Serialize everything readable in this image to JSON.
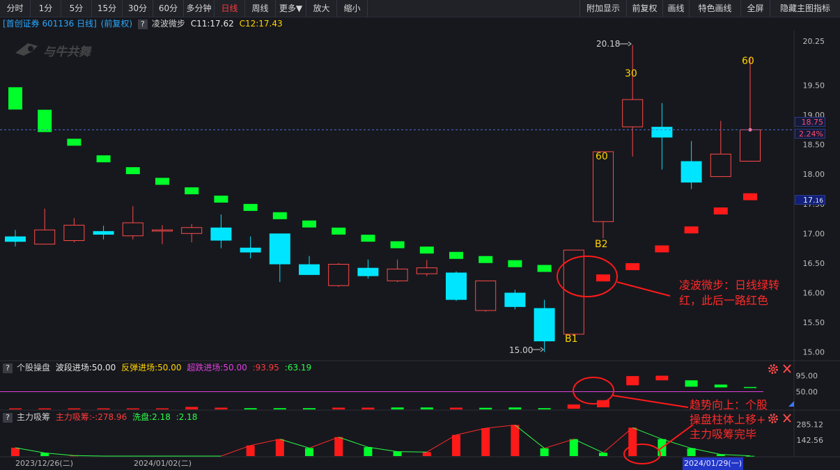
{
  "toolbar": {
    "left": [
      "分时",
      "1分",
      "5分",
      "15分",
      "30分",
      "60分",
      "多分钟",
      "日线",
      "周线",
      "更多▼",
      "放大",
      "缩小"
    ],
    "active": "日线",
    "right": [
      "附加显示",
      "前复权",
      "画线",
      "特色画线",
      "全屏",
      "隐藏主图指标"
    ]
  },
  "info": {
    "stock": "[首创证券 601136 日线]",
    "adj": "(前复权)",
    "help": "?",
    "indicator": "凌波微步",
    "c1": "C11:17.62",
    "c2": "C12:17.43"
  },
  "watermark": "与牛共舞",
  "price_axis": [
    "20.25",
    "19.50",
    "19.00",
    "18.50",
    "18.00",
    "17.50",
    "17.00",
    "16.50",
    "16.00",
    "15.50",
    "15.00"
  ],
  "price_labels": {
    "current": "18.75",
    "change": "2.24%",
    "c1_mark": "17.",
    "c1_mark_tail": "16"
  },
  "markers": {
    "high": "20.18",
    "low": "15.00",
    "n30": "30",
    "n60a": "60",
    "n60b": "60",
    "b1": "B1",
    "b2": "B2"
  },
  "sub1": {
    "help": "?",
    "name": "个股操盘",
    "l1": "波段进场:50.00",
    "l2": "反弹进场:50.00",
    "l3": "超跌进场:50.00",
    "v1": ":93.95",
    "v2": ":63.19",
    "axis": [
      "95.00",
      "50.00"
    ]
  },
  "sub2": {
    "help": "?",
    "name": "主力吸筹",
    "l1": "主力吸筹:-",
    "v1": ":278.96",
    "l2": "洗盘:2.18",
    "v2": ":2.18",
    "axis": [
      "285.12",
      "142.56"
    ]
  },
  "dates": [
    "2023/12/26(二)",
    "2024/01/02(二)",
    "2024/01/29(一)"
  ],
  "annotations": {
    "a1_l1": "凌波微步：日线绿转",
    "a1_l2": "红，此后一路红色",
    "a2_l1": "趋势向上：个股",
    "a2_l2": "操盘柱体上移+",
    "a2_l3": "主力吸筹完毕"
  },
  "colors": {
    "up": "#ff3b3b",
    "down": "#00e5ff",
    "green": "#00ff2a",
    "red": "#ff1a1a",
    "yellow": "#ffd400",
    "magenta": "#e040e0",
    "bg": "#17181d"
  },
  "chart_data": {
    "type": "candlestick",
    "ylim": [
      14.9,
      20.4
    ],
    "candles": [
      {
        "o": 16.95,
        "c": 16.86,
        "h": 17.06,
        "l": 16.78
      },
      {
        "o": 16.82,
        "c": 17.06,
        "h": 17.42,
        "l": 16.82
      },
      {
        "o": 16.88,
        "c": 17.14,
        "h": 17.26,
        "l": 16.85
      },
      {
        "o": 17.04,
        "c": 16.98,
        "h": 17.13,
        "l": 16.9
      },
      {
        "o": 16.96,
        "c": 17.18,
        "h": 17.46,
        "l": 16.9
      },
      {
        "o": 17.04,
        "c": 17.06,
        "h": 17.14,
        "l": 16.82
      },
      {
        "o": 17.0,
        "c": 17.1,
        "h": 17.16,
        "l": 16.85
      },
      {
        "o": 17.1,
        "c": 16.88,
        "h": 17.32,
        "l": 16.75
      },
      {
        "o": 16.76,
        "c": 16.68,
        "h": 16.95,
        "l": 16.58
      },
      {
        "o": 17.0,
        "c": 16.48,
        "h": 17.0,
        "l": 16.18
      },
      {
        "o": 16.48,
        "c": 16.3,
        "h": 16.62,
        "l": 16.3
      },
      {
        "o": 16.12,
        "c": 16.48,
        "h": 16.5,
        "l": 16.1
      },
      {
        "o": 16.42,
        "c": 16.28,
        "h": 16.56,
        "l": 16.24
      },
      {
        "o": 16.2,
        "c": 16.4,
        "h": 16.56,
        "l": 16.18
      },
      {
        "o": 16.32,
        "c": 16.42,
        "h": 16.55,
        "l": 16.28
      },
      {
        "o": 16.34,
        "c": 15.88,
        "h": 16.36,
        "l": 15.86
      },
      {
        "o": 15.7,
        "c": 16.2,
        "h": 16.2,
        "l": 15.68
      },
      {
        "o": 16.0,
        "c": 15.76,
        "h": 16.05,
        "l": 15.72
      },
      {
        "o": 15.74,
        "c": 15.18,
        "h": 15.88,
        "l": 15.0
      },
      {
        "o": 15.3,
        "c": 16.72,
        "h": 16.72,
        "l": 15.28
      },
      {
        "o": 17.2,
        "c": 18.38,
        "h": 18.38,
        "l": 16.92
      },
      {
        "o": 18.8,
        "c": 19.26,
        "h": 20.18,
        "l": 18.3
      },
      {
        "o": 18.8,
        "c": 18.62,
        "h": 19.2,
        "l": 18.08
      },
      {
        "o": 18.22,
        "c": 17.86,
        "h": 18.56,
        "l": 17.75
      },
      {
        "o": 17.96,
        "c": 18.34,
        "h": 18.9,
        "l": 17.96
      },
      {
        "o": 18.22,
        "c": 18.75,
        "h": 19.98,
        "l": 18.22
      }
    ],
    "lbwb": [
      {
        "v": 19.28,
        "color": "green"
      },
      {
        "v": 18.9,
        "color": "green"
      },
      {
        "v": 18.54,
        "color": "green"
      },
      {
        "v": 18.26,
        "color": "green"
      },
      {
        "v": 18.06,
        "color": "green"
      },
      {
        "v": 17.88,
        "color": "green"
      },
      {
        "v": 17.72,
        "color": "green"
      },
      {
        "v": 17.58,
        "color": "green"
      },
      {
        "v": 17.44,
        "color": "green"
      },
      {
        "v": 17.3,
        "color": "green"
      },
      {
        "v": 17.16,
        "color": "green"
      },
      {
        "v": 17.04,
        "color": "green"
      },
      {
        "v": 16.92,
        "color": "green"
      },
      {
        "v": 16.81,
        "color": "green"
      },
      {
        "v": 16.72,
        "color": "green"
      },
      {
        "v": 16.63,
        "color": "green"
      },
      {
        "v": 16.56,
        "color": "green"
      },
      {
        "v": 16.49,
        "color": "green"
      },
      {
        "v": 16.41,
        "color": "green"
      },
      {
        "v": 16.27,
        "color": "green"
      },
      {
        "v": 16.25,
        "color": "red"
      },
      {
        "v": 16.44,
        "color": "red"
      },
      {
        "v": 16.74,
        "color": "red"
      },
      {
        "v": 17.06,
        "color": "red"
      },
      {
        "v": 17.38,
        "color": "red"
      },
      {
        "v": 17.62,
        "color": "red"
      }
    ],
    "sub1_bars": [
      {
        "v": 1.5,
        "c": "red"
      },
      {
        "v": 0,
        "c": "red"
      },
      {
        "v": 2.0,
        "c": "red"
      },
      {
        "v": 2.0,
        "c": "red"
      },
      {
        "v": 2.5,
        "c": "red"
      },
      {
        "v": 3.0,
        "c": "red"
      },
      {
        "v": 7.0,
        "c": "red"
      },
      {
        "v": 5.0,
        "c": "red"
      },
      {
        "v": 3.5,
        "c": "green"
      },
      {
        "v": 3.5,
        "c": "green"
      },
      {
        "v": 3.5,
        "c": "green"
      },
      {
        "v": 5.0,
        "c": "red"
      },
      {
        "v": 5.0,
        "c": "red"
      },
      {
        "v": 5.5,
        "c": "green"
      },
      {
        "v": 5.5,
        "c": "green"
      },
      {
        "v": 5.0,
        "c": "red"
      },
      {
        "v": 4.5,
        "c": "green"
      },
      {
        "v": 5.5,
        "c": "green"
      },
      {
        "v": 3.5,
        "c": "green"
      },
      {
        "v": 14.0,
        "lo": 2.0,
        "c": "red"
      },
      {
        "v": 26.0,
        "lo": 6.0,
        "c": "red"
      },
      {
        "v": 93.95,
        "lo": 68.0,
        "c": "red"
      },
      {
        "v": 95.0,
        "lo": 82.0,
        "c": "red"
      },
      {
        "v": 82.0,
        "lo": 64.0,
        "c": "green"
      },
      {
        "v": 70.0,
        "lo": 62.0,
        "c": "green"
      },
      {
        "v": 63.19,
        "lo": 61.5,
        "c": "green"
      }
    ],
    "sub1_line": 50,
    "sub1_ylim": [
      0,
      102
    ],
    "sub2_bars": [
      {
        "v": 75,
        "c": "red"
      },
      {
        "v": 28,
        "c": "green"
      },
      {
        "v": 5,
        "c": "red"
      },
      {
        "v": 0,
        "c": "red"
      },
      {
        "v": 0,
        "c": "red"
      },
      {
        "v": 0,
        "c": "red"
      },
      {
        "v": 0,
        "c": "red"
      },
      {
        "v": 0,
        "c": "red"
      },
      {
        "v": 95,
        "c": "red"
      },
      {
        "v": 152,
        "c": "red"
      },
      {
        "v": 72,
        "c": "green"
      },
      {
        "v": 170,
        "c": "red"
      },
      {
        "v": 80,
        "c": "green"
      },
      {
        "v": 40,
        "c": "green"
      },
      {
        "v": 36,
        "c": "red"
      },
      {
        "v": 190,
        "c": "red"
      },
      {
        "v": 250,
        "c": "red"
      },
      {
        "v": 278.96,
        "c": "red"
      },
      {
        "v": 70,
        "c": "green"
      },
      {
        "v": 152,
        "c": "green"
      },
      {
        "v": 30,
        "c": "green"
      },
      {
        "v": 255,
        "c": "red"
      },
      {
        "v": 152,
        "c": "green"
      },
      {
        "v": 70,
        "c": "green"
      },
      {
        "v": 15,
        "c": "green"
      },
      {
        "v": 2.18,
        "c": "green"
      }
    ],
    "sub2_ylim": [
      0,
      300
    ]
  }
}
